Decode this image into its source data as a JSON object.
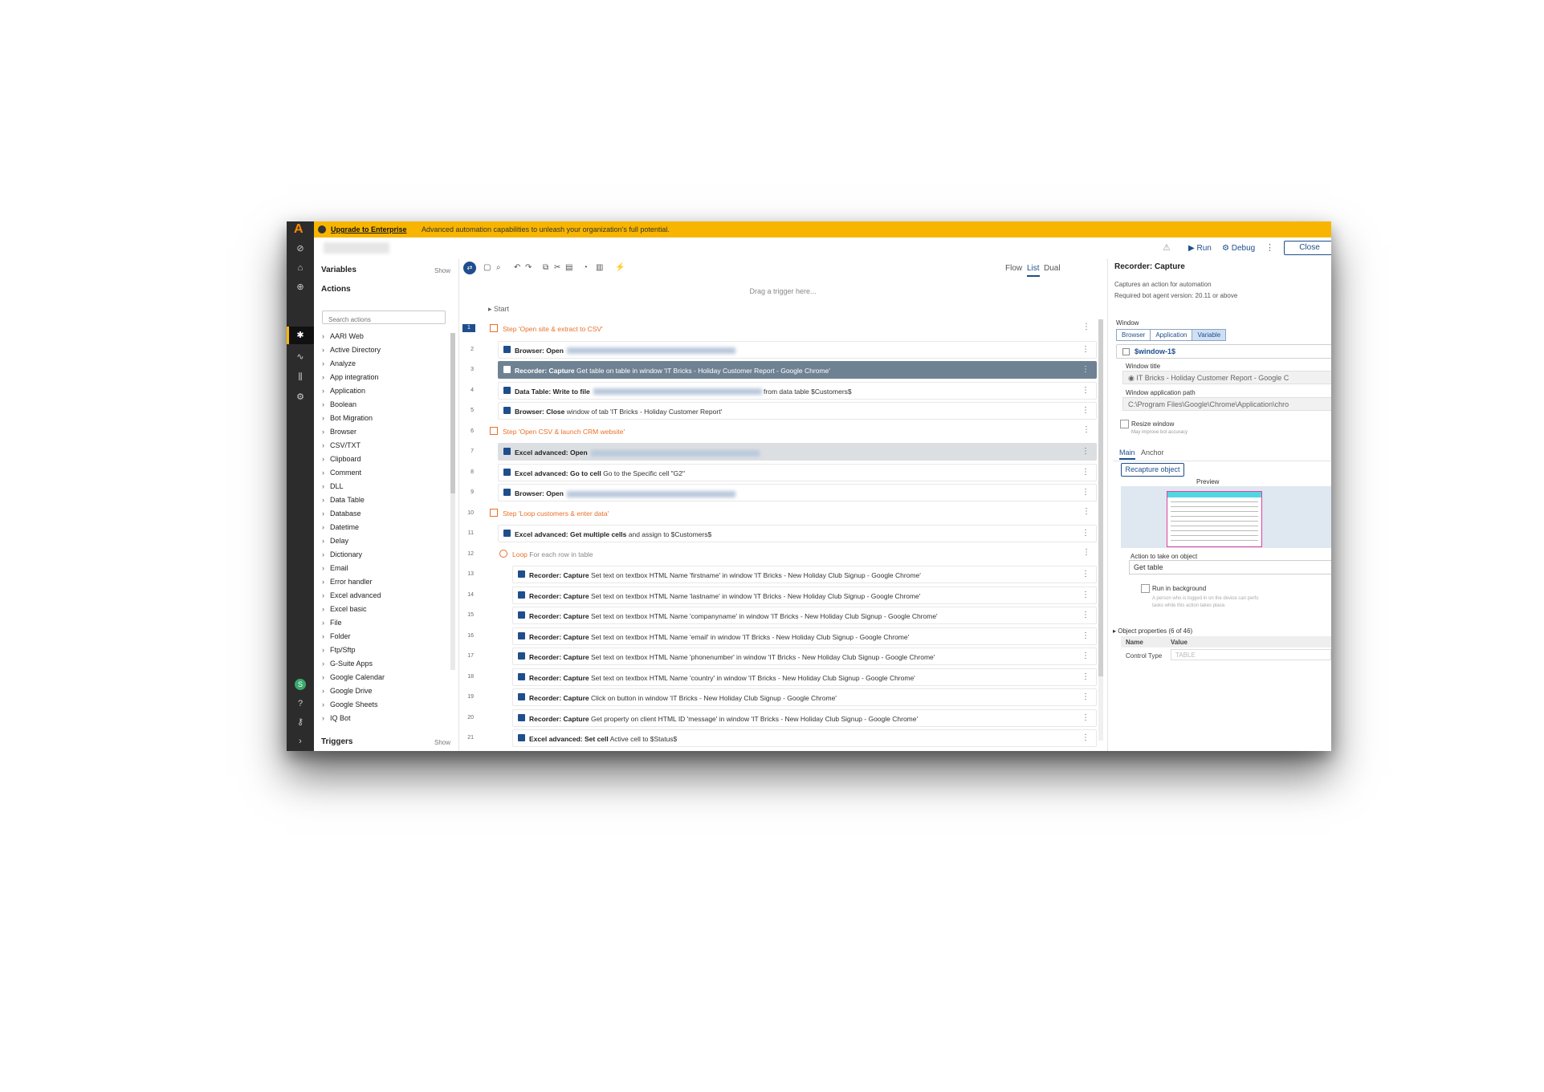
{
  "banner": {
    "upgrade_link": "Upgrade to Enterprise",
    "message": "Advanced automation capabilities to unleash your organization's full potential."
  },
  "header": {
    "run_label": "Run",
    "debug_label": "Debug",
    "close_label": "Close"
  },
  "left_panel": {
    "variables_label": "Variables",
    "variables_show": "Show",
    "actions_label": "Actions",
    "search_placeholder": "Search actions",
    "items": [
      "AARI Web",
      "Active Directory",
      "Analyze",
      "App integration",
      "Application",
      "Boolean",
      "Bot Migration",
      "Browser",
      "CSV/TXT",
      "Clipboard",
      "Comment",
      "DLL",
      "Data Table",
      "Database",
      "Datetime",
      "Delay",
      "Dictionary",
      "Email",
      "Error handler",
      "Excel advanced",
      "Excel basic",
      "File",
      "Folder",
      "Ftp/Sftp",
      "G-Suite Apps",
      "Google Calendar",
      "Google Drive",
      "Google Sheets",
      "IQ Bot"
    ],
    "triggers_label": "Triggers",
    "triggers_show": "Show"
  },
  "canvas": {
    "views": [
      "Flow",
      "List",
      "Dual"
    ],
    "selected_view": "List",
    "drag_hint": "Drag a trigger here...",
    "start_label": "Start",
    "rows": [
      {
        "n": "1",
        "kind": "step",
        "text": "Step 'Open site & extract to CSV'"
      },
      {
        "n": "2",
        "kind": "action",
        "bold": "Browser: Open",
        "rest": "",
        "blur": true
      },
      {
        "n": "3",
        "kind": "action",
        "bold": "Recorder: Capture",
        "rest": " Get table on table in window 'IT Bricks - Holiday Customer Report - Google Chrome'",
        "selected": true
      },
      {
        "n": "4",
        "kind": "action",
        "bold": "Data Table: Write to file",
        "rest": " from data table $Customers$",
        "blur": true
      },
      {
        "n": "5",
        "kind": "action",
        "bold": "Browser: Close",
        "rest": " window of tab 'IT Bricks - Holiday Customer Report'"
      },
      {
        "n": "6",
        "kind": "step",
        "text": "Step 'Open CSV & launch CRM website'"
      },
      {
        "n": "7",
        "kind": "action",
        "bold": "Excel advanced: Open",
        "rest": "",
        "blur": true,
        "grey": true
      },
      {
        "n": "8",
        "kind": "action",
        "bold": "Excel advanced: Go to cell",
        "rest": " Go to the Specific cell \"G2\""
      },
      {
        "n": "9",
        "kind": "action",
        "bold": "Browser: Open",
        "rest": "",
        "blur": true
      },
      {
        "n": "10",
        "kind": "step",
        "text": "Step 'Loop customers & enter data'"
      },
      {
        "n": "11",
        "kind": "action",
        "bold": "Excel advanced: Get multiple cells",
        "rest": " and assign to $Customers$"
      },
      {
        "n": "12",
        "kind": "loop",
        "text": "Loop",
        "rest": " For each row in table"
      },
      {
        "n": "13",
        "kind": "sub",
        "bold": "Recorder: Capture",
        "rest": " Set text on textbox HTML Name 'firstname' in window 'IT Bricks - New Holiday Club Signup - Google Chrome'"
      },
      {
        "n": "14",
        "kind": "sub",
        "bold": "Recorder: Capture",
        "rest": " Set text on textbox HTML Name 'lastname' in window 'IT Bricks - New Holiday Club Signup - Google Chrome'"
      },
      {
        "n": "15",
        "kind": "sub",
        "bold": "Recorder: Capture",
        "rest": " Set text on textbox HTML Name 'companyname' in window 'IT Bricks - New Holiday Club Signup - Google Chrome'"
      },
      {
        "n": "16",
        "kind": "sub",
        "bold": "Recorder: Capture",
        "rest": " Set text on textbox HTML Name 'email' in window 'IT Bricks - New Holiday Club Signup - Google Chrome'"
      },
      {
        "n": "17",
        "kind": "sub",
        "bold": "Recorder: Capture",
        "rest": " Set text on textbox HTML Name 'phonenumber' in window 'IT Bricks - New Holiday Club Signup - Google Chrome'"
      },
      {
        "n": "18",
        "kind": "sub",
        "bold": "Recorder: Capture",
        "rest": " Set text on textbox HTML Name 'country' in window 'IT Bricks - New Holiday Club Signup - Google Chrome'"
      },
      {
        "n": "19",
        "kind": "sub",
        "bold": "Recorder: Capture",
        "rest": " Click on button in window 'IT Bricks - New Holiday Club Signup - Google Chrome'"
      },
      {
        "n": "20",
        "kind": "sub",
        "bold": "Recorder: Capture",
        "rest": " Get property on client HTML ID 'message' in window 'IT Bricks - New Holiday Club Signup - Google Chrome'"
      },
      {
        "n": "21",
        "kind": "sub",
        "bold": "Excel advanced: Set cell",
        "rest": " Active cell to $Status$"
      }
    ]
  },
  "right_panel": {
    "title": "Recorder: Capture",
    "desc": "Captures an action for automation",
    "version": "Required bot agent version: 20.11 or above",
    "window_label": "Window",
    "window_tabs": [
      "Browser",
      "Application",
      "Variable"
    ],
    "window_selected": "Variable",
    "window_var": "$window-1$",
    "window_title_label": "Window title",
    "window_title_value": "IT Bricks - Holiday Customer Report - Google C",
    "app_path_label": "Window application path",
    "app_path_value": "C:\\Program Files\\Google\\Chrome\\Application\\chro",
    "resize_label": "Resize window",
    "resize_hint": "May improve bot accuracy",
    "tabs": [
      "Main",
      "Anchor"
    ],
    "recapture_label": "Recapture object",
    "preview_label": "Preview",
    "action_label": "Action to take on object",
    "action_value": "Get table",
    "run_bg_label": "Run in background",
    "run_bg_hint": "A person who is logged in on the device can perfo",
    "run_bg_hint2": "tasks while this action takes place.",
    "obj_props": "Object properties (6 of 46)",
    "col_name": "Name",
    "col_value": "Value",
    "prop_name": "Control Type",
    "prop_value": "TABLE"
  }
}
